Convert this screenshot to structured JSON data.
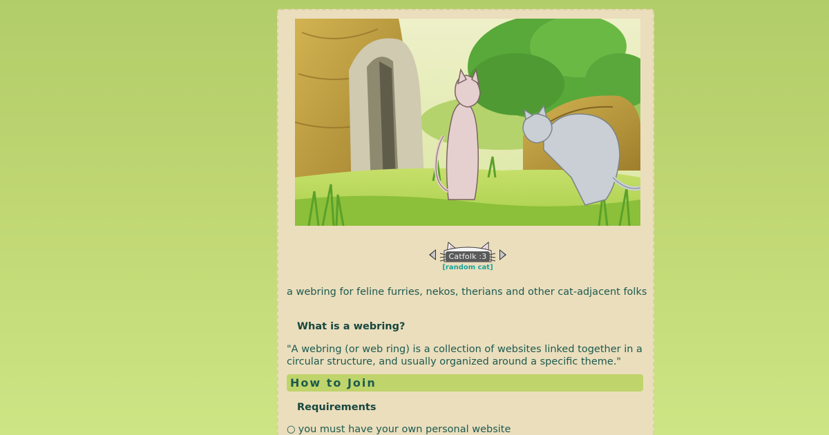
{
  "webring": {
    "badge_text": "Catfolk :3",
    "random_label": "[random cat]"
  },
  "tagline": "a webring for feline furries, nekos, therians and other cat-adjacent folks",
  "what_is": {
    "heading": "What is a webring?",
    "quote": "\"A webring (or web ring) is a collection of websites linked together in a circular structure, and usually organized around a specific theme.\""
  },
  "how_to_join": {
    "heading": "How to Join",
    "requirements_heading": "Requirements",
    "requirements": [
      {
        "bullet": "○",
        "text": "you must have your own personal website"
      }
    ]
  },
  "colors": {
    "page_bg": "#bfd673",
    "card_bg": "#ebdebd",
    "text": "#1b5a4f",
    "accent_bar": "#bfd46b",
    "link": "#1aa39c"
  }
}
